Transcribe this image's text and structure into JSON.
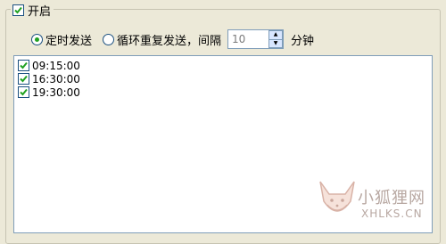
{
  "group": {
    "title": "开启",
    "enabled": true
  },
  "schedule": {
    "option_timed": "定时发送",
    "option_timed_selected": true,
    "option_repeat": "循环重复发送，间隔",
    "option_repeat_selected": false,
    "interval_value": "10",
    "interval_unit": "分钟"
  },
  "times": [
    {
      "label": "09:15:00",
      "checked": true
    },
    {
      "label": "16:30:00",
      "checked": true
    },
    {
      "label": "19:30:00",
      "checked": true
    }
  ],
  "watermark": {
    "name": "小狐狸网",
    "site": "XHLKS.CN"
  },
  "colors": {
    "background": "#ECE9D8",
    "check_mark": "#21A121",
    "border_blue": "#1C5180"
  }
}
